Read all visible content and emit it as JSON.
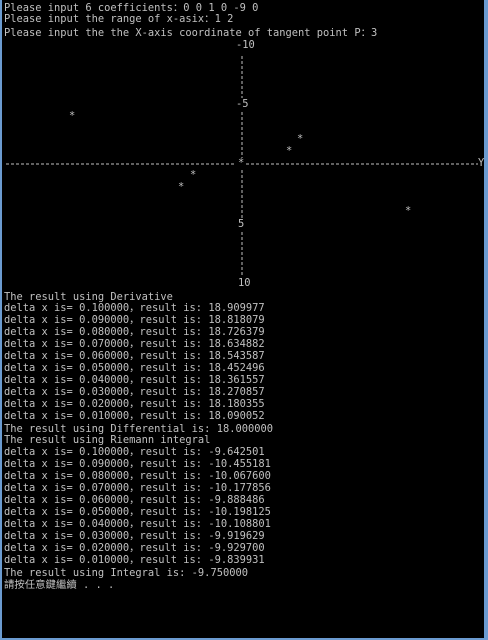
{
  "console": {
    "prompts": [
      "Please input 6 coefficients：0 0 1 0 -9 0",
      "Please input the range of x-asix：1 2",
      "Please input the the X-axis coordinate of tangent point P：3"
    ],
    "axis_labels": {
      "top": "-10",
      "upper_mid": "-5",
      "center": "0",
      "lower_mid": "5",
      "bottom": "10",
      "right": "Y"
    },
    "plot_marker": "*",
    "derivative_header": "The result using Derivative",
    "derivative_rows": [
      "delta x is= 0.100000，result is: 18.909977",
      "delta x is= 0.090000，result is: 18.818079",
      "delta x is= 0.080000，result is: 18.726379",
      "delta x is= 0.070000，result is: 18.634882",
      "delta x is= 0.060000，result is: 18.543587",
      "delta x is= 0.050000，result is: 18.452496",
      "delta x is= 0.040000，result is: 18.361557",
      "delta x is= 0.030000，result is: 18.270857",
      "delta x is= 0.020000，result is: 18.180355",
      "delta x is= 0.010000，result is: 18.090052"
    ],
    "differential_line": "The result using Differential is: 18.000000",
    "riemann_header": "The result using Riemann integral",
    "riemann_rows": [
      "delta x is= 0.100000，result is: -9.642501",
      "delta x is= 0.090000，result is: -10.455181",
      "delta x is= 0.080000，result is: -10.067600",
      "delta x is= 0.070000，result is: -10.177856",
      "delta x is= 0.060000，result is: -9.888486",
      "delta x is= 0.050000，result is: -10.198125",
      "delta x is= 0.040000，result is: -10.108801",
      "delta x is= 0.030000，result is: -9.919629",
      "delta x is= 0.020000，result is: -9.929700",
      "delta x is= 0.010000，result is: -9.839931"
    ],
    "integral_line": "The result using Integral is: -9.750000",
    "pause_line": "請按任意鍵繼續 . . ."
  },
  "colors": {
    "background": "#000000",
    "text": "#c0c0c0",
    "window_frame": "#6b9bd0"
  }
}
